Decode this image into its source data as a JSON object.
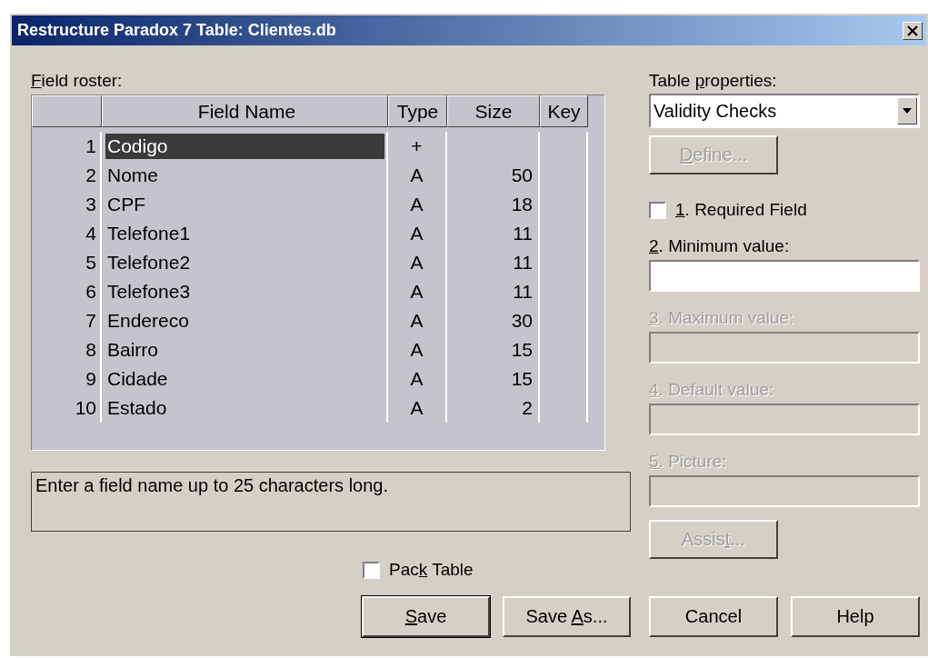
{
  "window": {
    "title": "Restructure Paradox 7 Table: Clientes.db"
  },
  "field_roster": {
    "label": {
      "key": "F",
      "post": "ield roster:"
    },
    "columns": [
      "Field Name",
      "Type",
      "Size",
      "Key"
    ],
    "rows": [
      {
        "number": "1",
        "name": "Codigo",
        "type": "+",
        "selected": true
      },
      {
        "number": "2",
        "name": "Nome",
        "type": "A",
        "size": "50",
        "selected": false
      },
      {
        "number": "3",
        "name": "CPF",
        "type": "A",
        "size": "18",
        "selected": false
      },
      {
        "number": "4",
        "name": "Telefone1",
        "type": "A",
        "size": "11",
        "selected": false
      },
      {
        "number": "5",
        "name": "Telefone2",
        "type": "A",
        "size": "11",
        "selected": false
      },
      {
        "number": "6",
        "name": "Telefone3",
        "type": "A",
        "size": "11",
        "selected": false
      },
      {
        "number": "7",
        "name": "Endereco",
        "type": "A",
        "size": "30",
        "selected": false
      },
      {
        "number": "8",
        "name": "Bairro",
        "type": "A",
        "size": "15",
        "selected": false
      },
      {
        "number": "9",
        "name": "Cidade",
        "type": "A",
        "size": "15",
        "selected": false
      },
      {
        "number": "10",
        "name": "Estado",
        "type": "A",
        "size": "2",
        "selected": false
      }
    ]
  },
  "hint": "Enter a field name up to 25 characters long.",
  "pack_table": {
    "label": {
      "pre": "Pac",
      "key": "k",
      "post": " Table"
    },
    "checked": false
  },
  "save_buttons": [
    {
      "label": {
        "key": "S",
        "post": "ave"
      },
      "default": true
    },
    {
      "label": {
        "pre": "Save ",
        "key": "A",
        "post": "s..."
      },
      "default": false
    }
  ],
  "table_properties": {
    "label": {
      "pre": "Table ",
      "key": "p",
      "post": "roperties:"
    },
    "value": "Validity Checks"
  },
  "define_button": {
    "label": {
      "key": "D",
      "post": "efine..."
    },
    "disabled": true
  },
  "required_field": {
    "label": {
      "key": "1",
      "post": ". Required Field"
    },
    "checked": false
  },
  "value_fields": [
    {
      "label": {
        "key": "2",
        "post": ". Minimum value:"
      },
      "disabled": false
    },
    {
      "label": {
        "key": "3",
        "post": ". Maximum value:"
      },
      "disabled": true
    },
    {
      "label": {
        "key": "4",
        "post": ". Default value:"
      },
      "disabled": true
    },
    {
      "label": {
        "key": "5",
        "post": ". Picture:"
      },
      "disabled": true
    }
  ],
  "assist_button": {
    "label": {
      "pre": "Assis",
      "key": "t",
      "post": "..."
    },
    "disabled": true
  },
  "dialog_buttons": [
    {
      "label": "Cancel"
    },
    {
      "label": "Help"
    }
  ]
}
